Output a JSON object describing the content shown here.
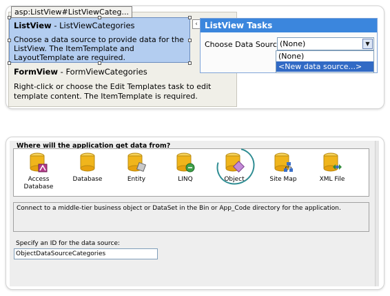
{
  "top": {
    "tag_label": "asp:ListView#ListViewCateg...",
    "listview": {
      "title_bold": "ListView",
      "title_rest": " - ListViewCategories",
      "description": "Choose a data source to provide data for the ListView. The ItemTemplate and LayoutTemplate are required."
    },
    "formview": {
      "title_bold": "FormView",
      "title_rest": " - FormViewCategories",
      "description": "Right-click or choose the Edit Templates task to edit template content. The ItemTemplate is required."
    },
    "tasks": {
      "header": "ListView Tasks",
      "label": "Choose Data Source:",
      "selected": "(None)",
      "options": [
        "(None)",
        "<New data source...>"
      ],
      "highlighted_index": 1
    }
  },
  "wizard": {
    "question": "Where will the application get data from?",
    "sources": [
      {
        "label": "Access\nDatabase",
        "icon": "access-database-icon"
      },
      {
        "label": "Database",
        "icon": "database-icon"
      },
      {
        "label": "Entity",
        "icon": "entity-icon"
      },
      {
        "label": "LINQ",
        "icon": "linq-icon"
      },
      {
        "label": "Object",
        "icon": "object-icon"
      },
      {
        "label": "Site Map",
        "icon": "site-map-icon"
      },
      {
        "label": "XML File",
        "icon": "xml-file-icon"
      }
    ],
    "selected_source": "Object",
    "description": "Connect to a middle-tier business object or DataSet in the Bin or App_Code directory for the application.",
    "id_label": "Specify an ID for the data source:",
    "id_value": "ObjectDataSourceCategories"
  },
  "colors": {
    "tasks_header": "#3b86dd",
    "listview_fill": "#b3cdf0",
    "highlight_ring": "#2e8c92",
    "dropdown_selection": "#316ac5"
  }
}
